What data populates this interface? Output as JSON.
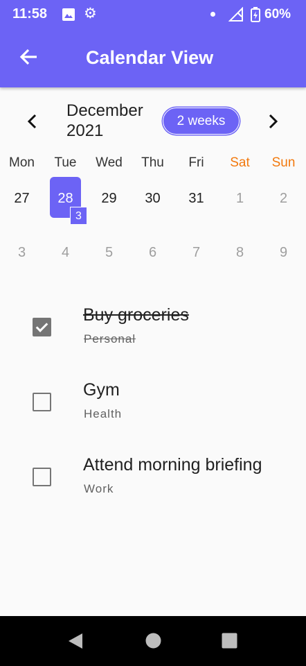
{
  "status_bar": {
    "time": "11:58",
    "battery": "60%"
  },
  "app_bar": {
    "title": "Calendar View"
  },
  "calendar": {
    "month": "December 2021",
    "format_button": "2 weeks",
    "weekdays": [
      "Mon",
      "Tue",
      "Wed",
      "Thu",
      "Fri",
      "Sat",
      "Sun"
    ],
    "week1": [
      "27",
      "28",
      "29",
      "30",
      "31",
      "1",
      "2"
    ],
    "week2": [
      "3",
      "4",
      "5",
      "6",
      "7",
      "8",
      "9"
    ],
    "selected_marker": "3"
  },
  "tasks": [
    {
      "title": "Buy groceries",
      "category": "Personal",
      "completed": true
    },
    {
      "title": "Gym",
      "category": "Health",
      "completed": false
    },
    {
      "title": "Attend morning briefing",
      "category": "Work",
      "completed": false
    }
  ],
  "colors": {
    "primary": "#6c63f5",
    "weekend": "#f2790e"
  }
}
